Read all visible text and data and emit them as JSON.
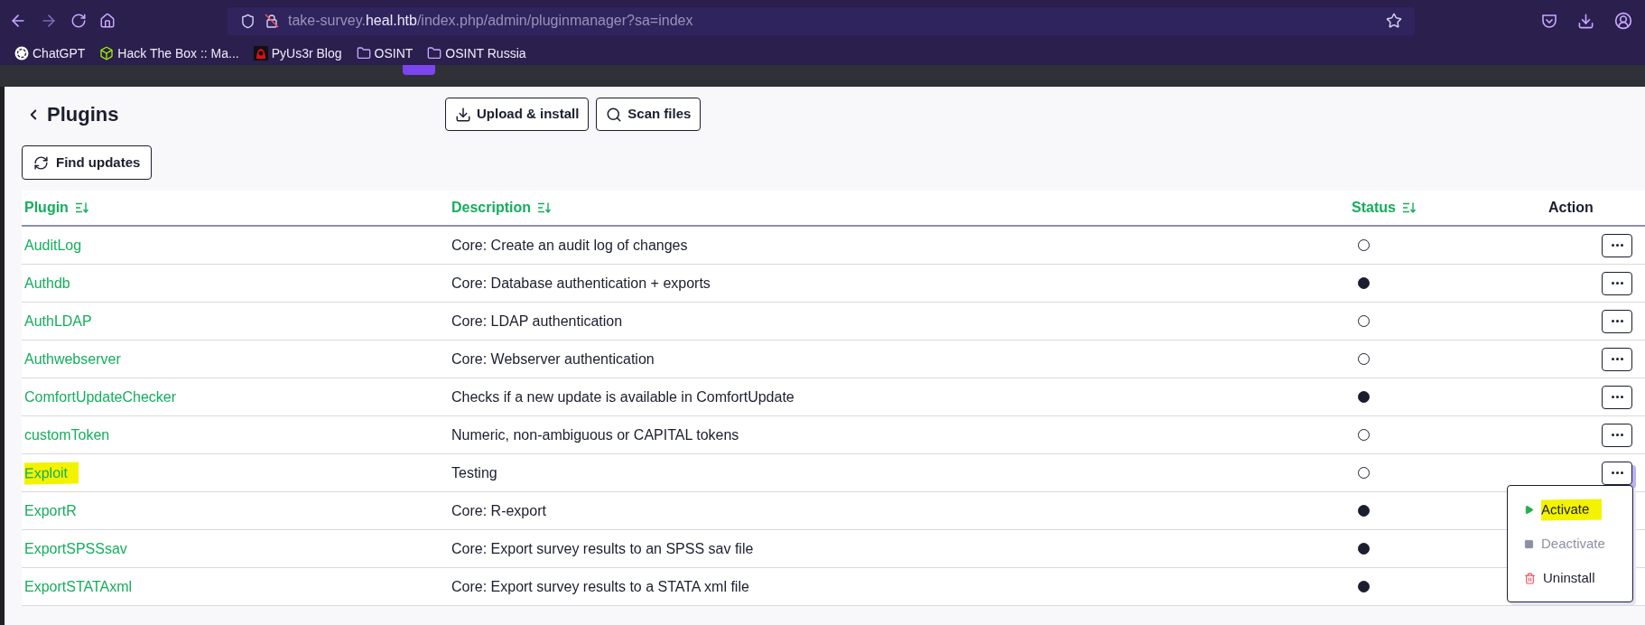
{
  "browser": {
    "url": {
      "subdomain": "take-survey.",
      "domain": "heal.htb",
      "path": "/index.php/admin/pluginmanager?sa=index"
    },
    "bookmarks": [
      {
        "label": "ChatGPT",
        "kind": "swirl"
      },
      {
        "label": "Hack The Box :: Ma...",
        "kind": "cube"
      },
      {
        "label": "PyUs3r Blog",
        "kind": "avatar"
      },
      {
        "label": "OSINT",
        "kind": "folder"
      },
      {
        "label": "OSINT Russia",
        "kind": "folder"
      }
    ]
  },
  "page": {
    "title": "Plugins",
    "toolbar": [
      {
        "label": "Upload & install",
        "kind": "download"
      },
      {
        "label": "Scan files",
        "kind": "search"
      }
    ],
    "find_updates": {
      "label": "Find updates"
    }
  },
  "table": {
    "columns": [
      {
        "label": "Plugin",
        "sortable": true
      },
      {
        "label": "Description",
        "sortable": true
      },
      {
        "label": "Status",
        "sortable": true
      },
      {
        "label": "Action",
        "sortable": false
      }
    ],
    "rows": [
      {
        "name": "AuditLog",
        "description": "Core: Create an audit log of changes",
        "active": false,
        "highlighted": false,
        "menu_open": false
      },
      {
        "name": "Authdb",
        "description": "Core: Database authentication + exports",
        "active": true,
        "highlighted": false,
        "menu_open": false
      },
      {
        "name": "AuthLDAP",
        "description": "Core: LDAP authentication",
        "active": false,
        "highlighted": false,
        "menu_open": false
      },
      {
        "name": "Authwebserver",
        "description": "Core: Webserver authentication",
        "active": false,
        "highlighted": false,
        "menu_open": false
      },
      {
        "name": "ComfortUpdateChecker",
        "description": "Checks if a new update is available in ComfortUpdate",
        "active": true,
        "highlighted": false,
        "menu_open": false
      },
      {
        "name": "customToken",
        "description": "Numeric, non-ambiguous or CAPITAL tokens",
        "active": false,
        "highlighted": false,
        "menu_open": false
      },
      {
        "name": "Exploit",
        "description": "Testing",
        "active": false,
        "highlighted": true,
        "menu_open": true
      },
      {
        "name": "ExportR",
        "description": "Core: R-export",
        "active": true,
        "highlighted": false
      },
      {
        "name": "ExportSPSSsav",
        "description": "Core: Export survey results to an SPSS sav file",
        "active": true,
        "highlighted": false
      },
      {
        "name": "ExportSTATAxml",
        "description": "Core: Export survey results to a STATA xml file",
        "active": true,
        "highlighted": false
      }
    ],
    "action_menu": [
      {
        "label": "Activate",
        "kind": "play",
        "disabled": false,
        "highlighted": true
      },
      {
        "label": "Deactivate",
        "kind": "stop",
        "disabled": true,
        "highlighted": false
      },
      {
        "label": "Uninstall",
        "kind": "trash",
        "disabled": false,
        "highlighted": false
      }
    ]
  }
}
